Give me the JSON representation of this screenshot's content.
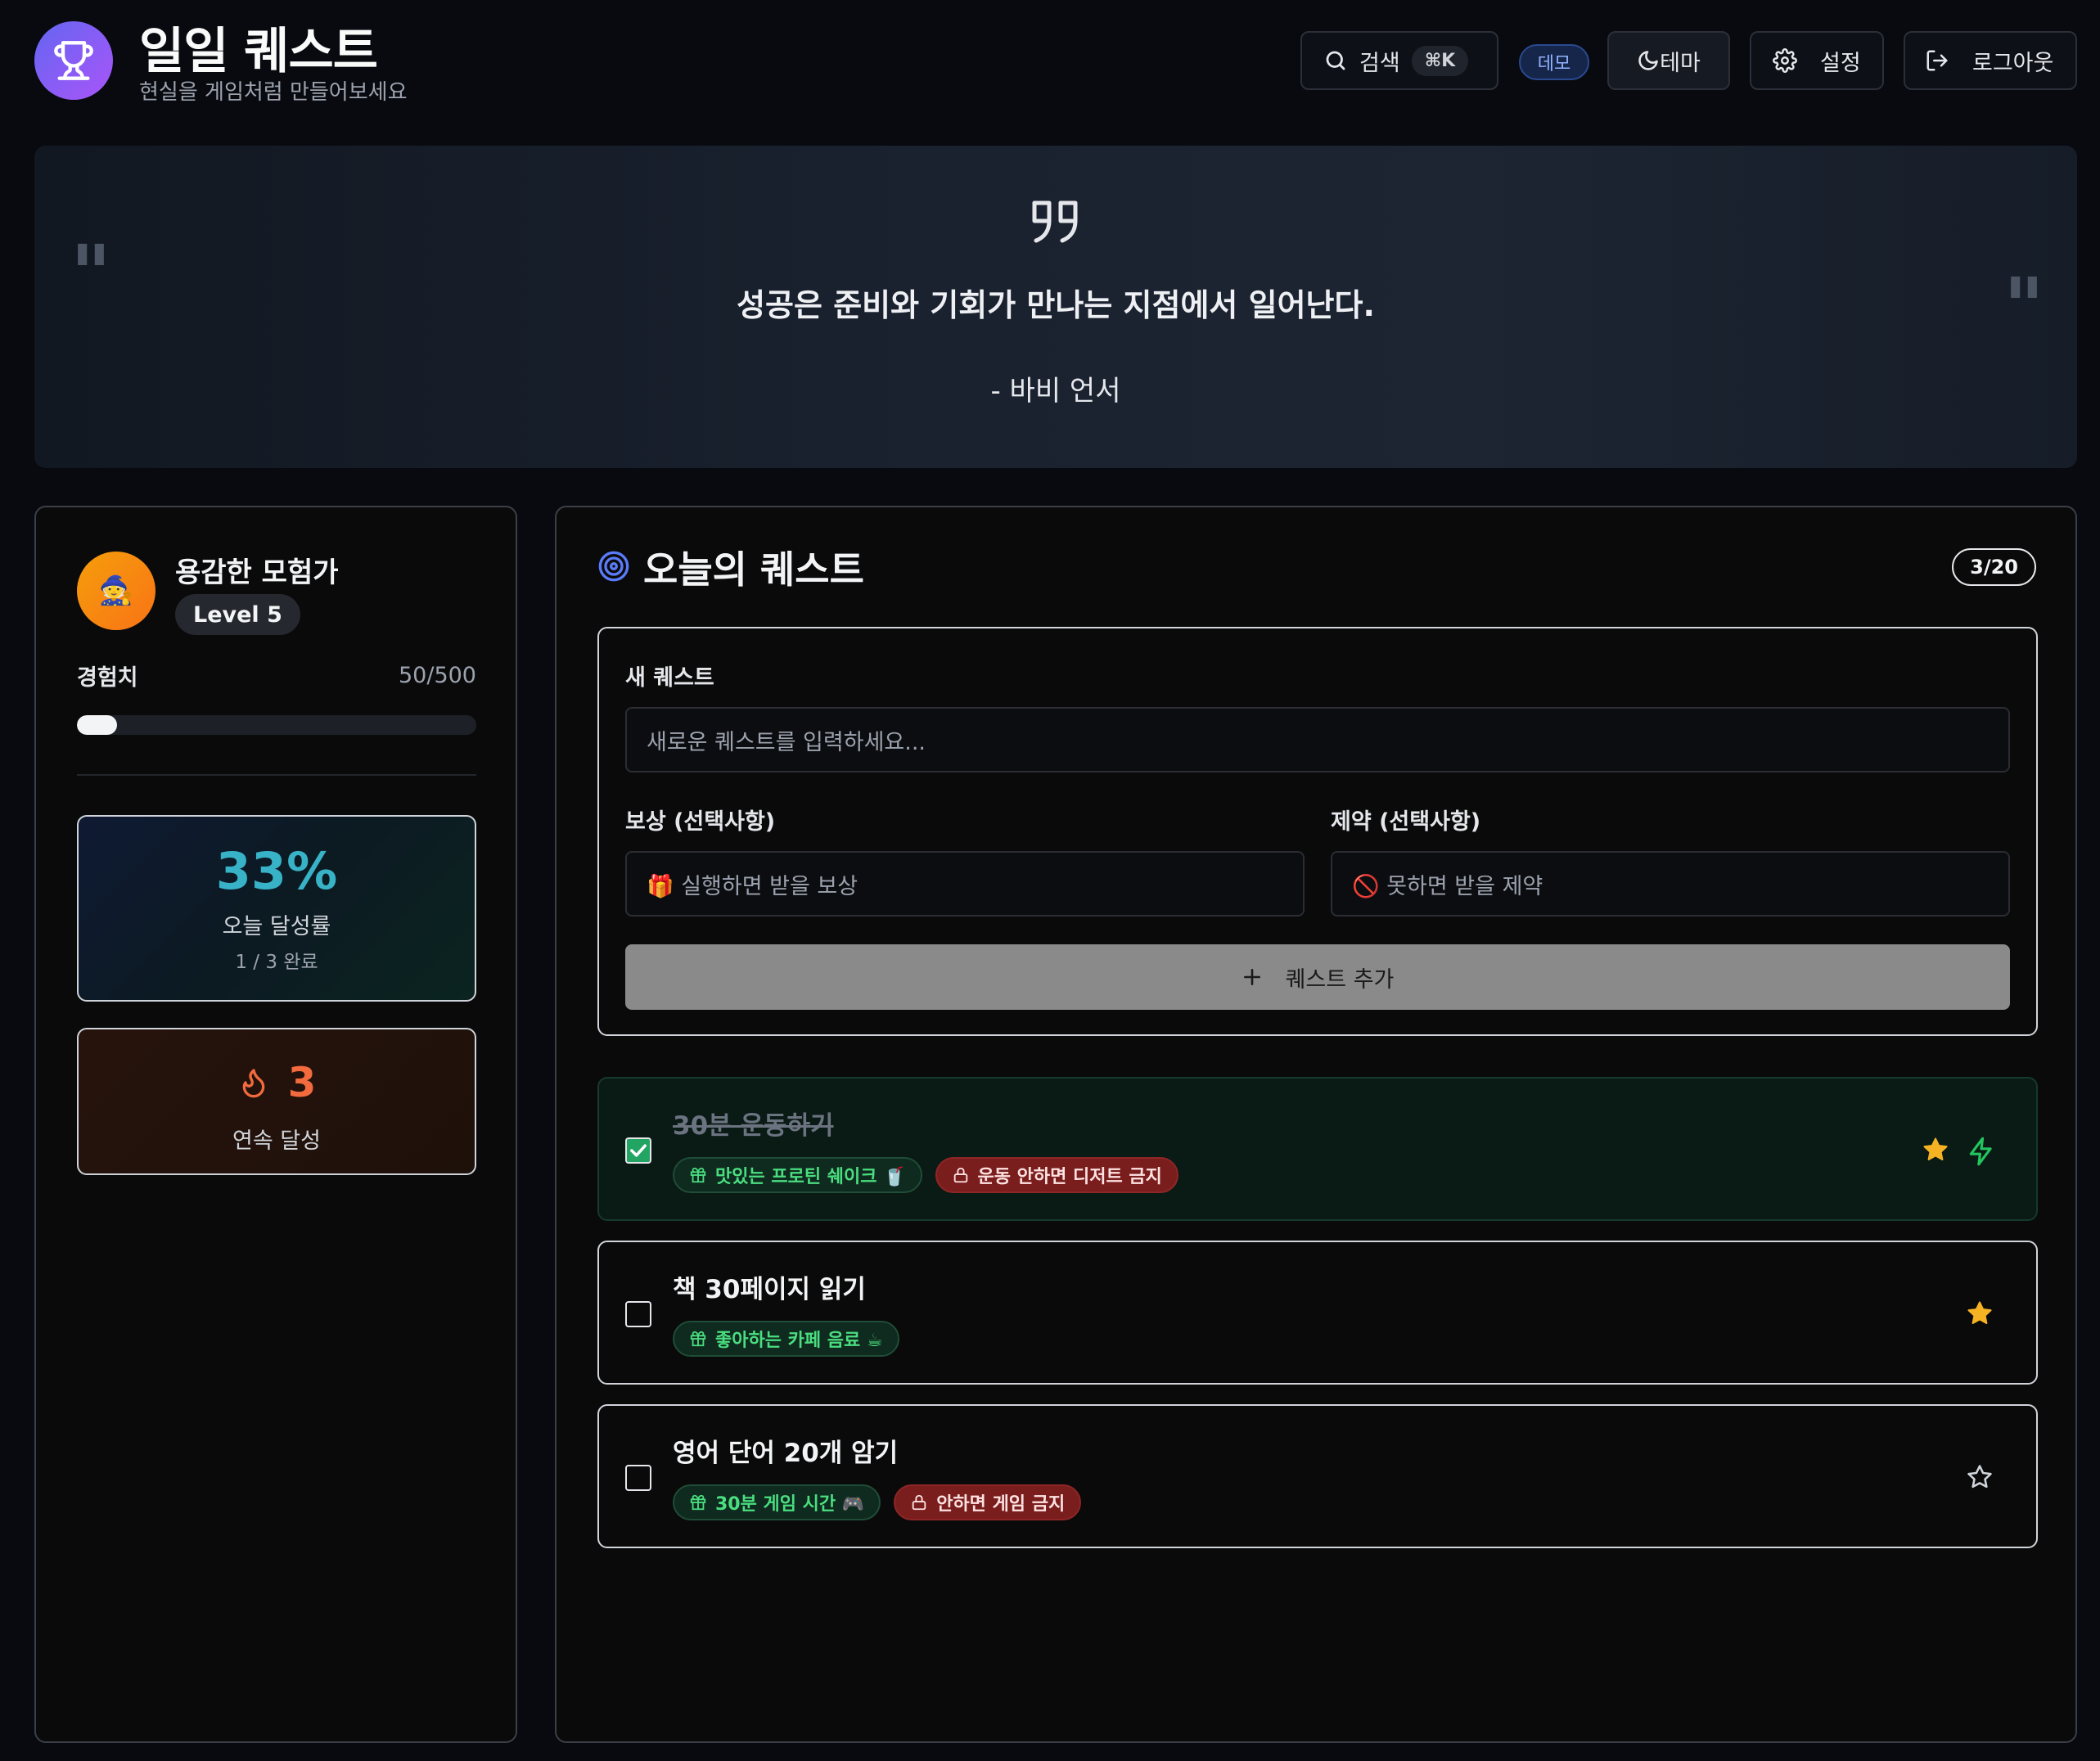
{
  "header": {
    "title": "일일 퀘스트",
    "subtitle": "현실을 게임처럼 만들어보세요",
    "search_label": "검색",
    "search_shortcut": "⌘K",
    "demo_badge": "데모",
    "theme_label": "테마",
    "settings_label": "설정",
    "logout_label": "로그아웃"
  },
  "quote": {
    "text": "성공은 준비와 기회가 만나는 지점에서 일어난다.",
    "author": "- 바비 언서",
    "open_mark": "\"",
    "close_mark": "\""
  },
  "profile": {
    "avatar_emoji": "🧙",
    "name": "용감한 모험가",
    "level": "Level 5",
    "xp_label": "경험치",
    "xp_value": "50/500",
    "xp_progress": 0.1,
    "completion_rate": "33%",
    "completion_label": "오늘 달성률",
    "completion_detail": "1 / 3 완료",
    "streak_value": "3",
    "streak_label": "연속 달성"
  },
  "quests_panel": {
    "title": "오늘의 퀘스트",
    "count": "3/20",
    "form": {
      "new_label": "새 퀘스트",
      "new_placeholder": "새로운 퀘스트를 입력하세요...",
      "reward_label": "보상 (선택사항)",
      "reward_placeholder": "🎁 실행하면 받을 보상",
      "penalty_label": "제약 (선택사항)",
      "penalty_placeholder": "🚫 못하면 받을 제약",
      "add_button": "퀘스트 추가"
    },
    "items": [
      {
        "title": "30분 운동하기",
        "completed": true,
        "reward": "맛있는 프로틴 쉐이크 🥤",
        "penalty": "운동 안하면 디저트 금지",
        "starred": true
      },
      {
        "title": "책 30페이지 읽기",
        "completed": false,
        "reward": "좋아하는 카페 음료 ☕",
        "penalty": "",
        "starred": true
      },
      {
        "title": "영어 단어 20개 암기",
        "completed": false,
        "reward": "30분 게임 시간 🎮",
        "penalty": "안하면 게임 금지",
        "starred": false
      }
    ]
  },
  "colors": {
    "accent_purple": "#8b5cf6",
    "rate_cyan": "#38b2c6",
    "streak_orange": "#f26a3d",
    "reward_green": "#4ade80",
    "penalty_red": "#7a1d1d",
    "star_gold": "#f5b324"
  }
}
